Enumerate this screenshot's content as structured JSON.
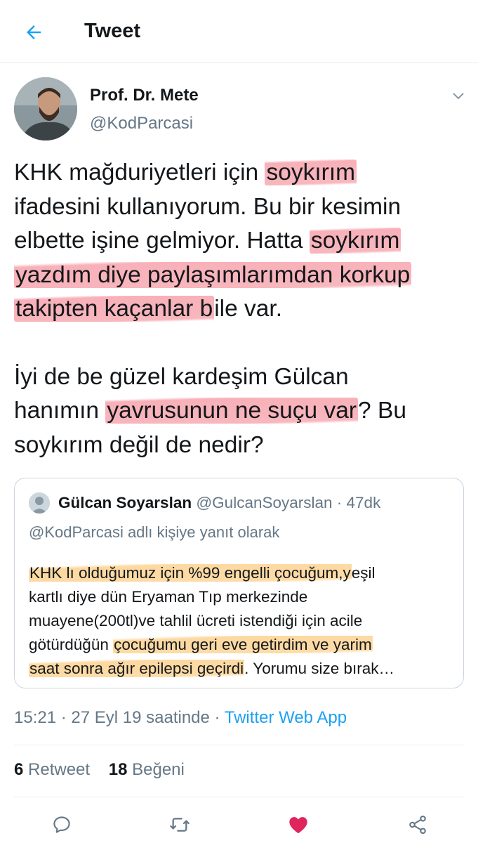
{
  "header": {
    "title": "Tweet"
  },
  "tweet": {
    "author_name": "Prof. Dr. Mete",
    "author_handle": "@KodParcasi",
    "p1": {
      "l1_a": "KHK mağduriyetleri için ",
      "l1_hl": "soykırım",
      "l2": "ifadesini kullanıyorum. Bu bir kesimin",
      "l3_a": "elbette işine gelmiyor. Hatta ",
      "l3_hl": "soykırım",
      "l4_hl": "yazdım diye paylaşımlarımdan korkup",
      "l5_hl": "takipten kaçanlar b",
      "l5_b": "ile var."
    },
    "p2": {
      "l1": "İyi de be güzel kardeşim Gülcan",
      "l2_a": "hanımın ",
      "l2_hl": "yavrusunun ne suçu var",
      "l2_b": "? Bu",
      "l3": "soykırım değil de nedir?"
    },
    "timestamp": "15:21 · 27 Eyl 19 saatinde · ",
    "source": "Twitter Web App",
    "retweets": "6",
    "retweets_label": "Retweet",
    "likes": "18",
    "likes_label": "Beğeni"
  },
  "quote": {
    "name": "Gülcan Soyarslan",
    "meta": "@GulcanSoyarslan · 47dk",
    "reply_to": "@KodParcasi adlı kişiye yanıt olarak",
    "l1_hl": "KHK lı olduğumuz için %99 engelli çocuğum,y",
    "l1_b": "eşil",
    "l2": "kartlı diye dün Eryaman Tıp merkezinde",
    "l3": "muayene(200tl)ve tahlil ücreti istendiği için acile",
    "l4_a": "götürdüğün ",
    "l4_hl": "çocuğumu geri eve getirdim ve yarim",
    "l5_hl": "saat sonra ağır epilepsi geçirdi",
    "l5_b": ". Yorumu size bırak…"
  },
  "icons": {
    "back": "arrow-left-icon",
    "caret": "chevron-down-icon",
    "reply": "reply-icon",
    "retweet": "retweet-icon",
    "like": "heart-icon",
    "share": "share-icon"
  },
  "colors": {
    "accent": "#1da1f2",
    "secondary_text": "#657786",
    "like": "#e0245e",
    "highlight_pink": "#f4808e",
    "highlight_orange": "#fcc46e"
  }
}
